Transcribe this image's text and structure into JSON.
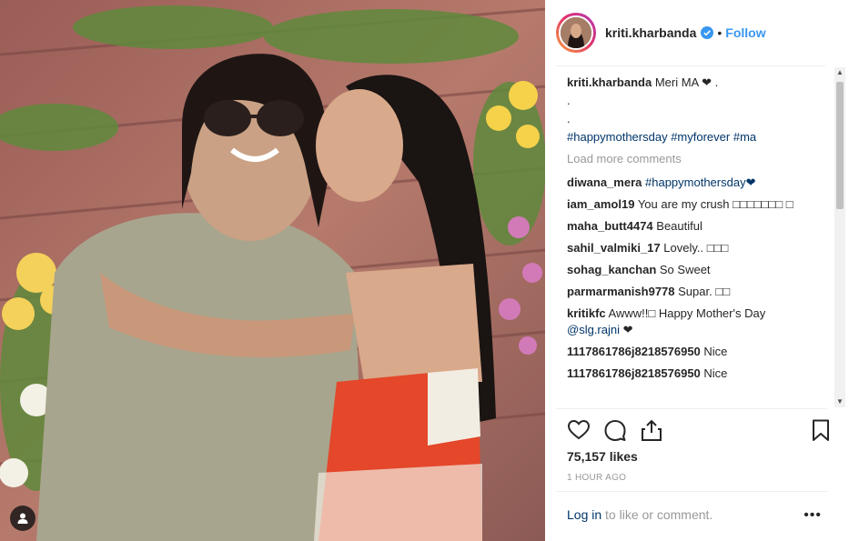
{
  "post": {
    "username": "kriti.kharbanda",
    "follow_label": "Follow",
    "separator": "•",
    "caption": {
      "username": "kriti.kharbanda",
      "text": "Meri MA ❤ .",
      "line2": ".",
      "line3": ".",
      "hashtags": [
        "#happymothersday",
        "#myforever",
        "#ma"
      ]
    },
    "load_more_label": "Load more comments",
    "comments": [
      {
        "user": "diwana_mera",
        "text": "#happymothersday❤",
        "text_is_tag": true
      },
      {
        "user": "iam_amol19",
        "text": "You are my crush □□□□□□□ □"
      },
      {
        "user": "maha_butt4474",
        "text": "Beautiful"
      },
      {
        "user": "sahil_valmiki_17",
        "text": "Lovely.. □□□"
      },
      {
        "user": "sohag_kanchan",
        "text": "So Sweet"
      },
      {
        "user": "parmarmanish9778",
        "text": "Supar. □□"
      },
      {
        "user": "kritikfc",
        "text": "Awww!!□ Happy Mother's Day",
        "mention": "@slg.rajni",
        "after_mention": " ❤"
      },
      {
        "user": "1117861786j8218576950",
        "text": "Nice"
      },
      {
        "user": "1117861786j8218576950",
        "text": "Nice"
      }
    ],
    "likes_label": "75,157 likes",
    "time_label": "1 HOUR AGO",
    "login": {
      "link": "Log in",
      "rest": " to like or comment."
    },
    "more_label": "•••"
  },
  "icons": {
    "like": "heart-icon",
    "comment": "comment-icon",
    "share": "share-icon",
    "save": "bookmark-icon",
    "verified": "verified-badge-icon",
    "tag": "user-tag-icon"
  },
  "colors": {
    "accent": "#3897f0",
    "link": "#003569",
    "muted": "#999999",
    "text": "#262626"
  }
}
